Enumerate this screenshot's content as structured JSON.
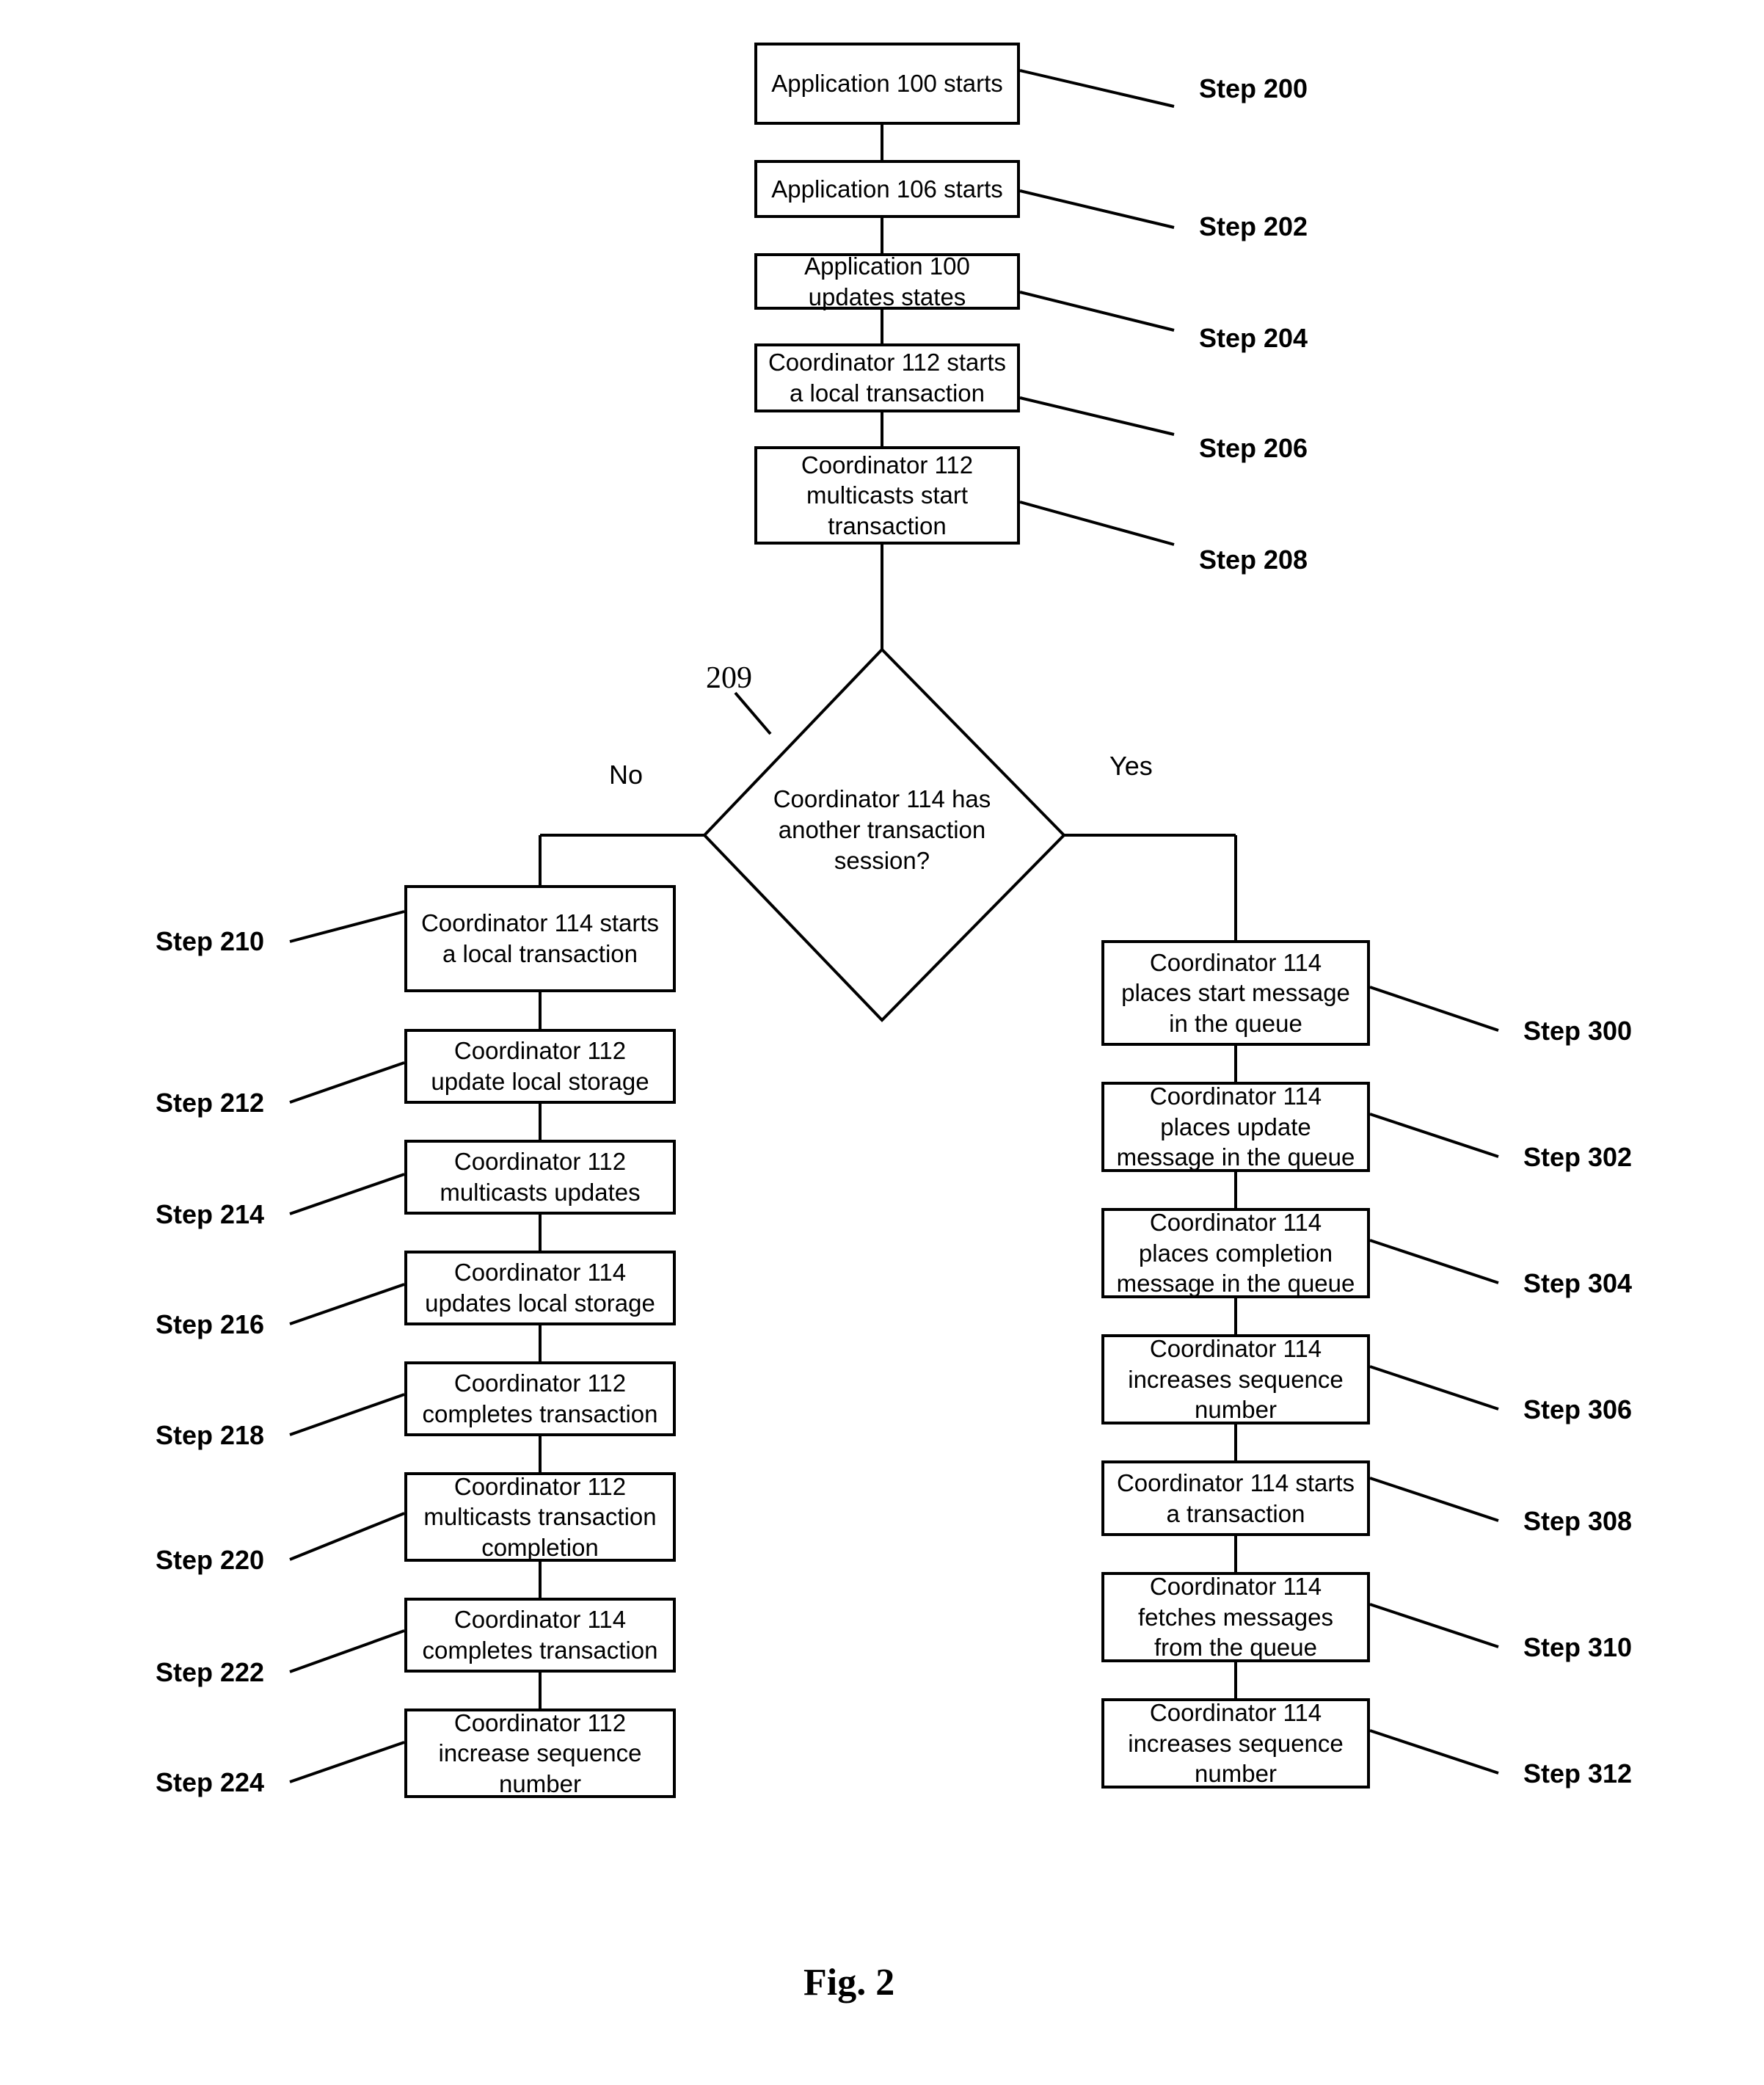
{
  "figure": {
    "caption": "Fig. 2",
    "reference_numeral": "209"
  },
  "branches": {
    "no_label": "No",
    "yes_label": "Yes"
  },
  "decision": {
    "text": "Coordinator 114 has\nanother transaction\nsession?",
    "step_ref": "209"
  },
  "main_column": {
    "nodes": [
      {
        "text": "Application 100 starts",
        "step": "Step 200"
      },
      {
        "text": "Application 106 starts",
        "step": "Step 202"
      },
      {
        "text": "Application 100\nupdates states",
        "step": "Step 204"
      },
      {
        "text": "Coordinator 112 starts\na local transaction",
        "step": "Step 206"
      },
      {
        "text": "Coordinator 112\nmulticasts start\ntransaction",
        "step": "Step 208"
      }
    ]
  },
  "no_column": {
    "nodes": [
      {
        "text": "Coordinator 114 starts\na local transaction",
        "step": "Step 210"
      },
      {
        "text": "Coordinator 112\nupdate local storage",
        "step": "Step 212"
      },
      {
        "text": "Coordinator 112\nmulticasts updates",
        "step": "Step 214"
      },
      {
        "text": "Coordinator 114\nupdates local storage",
        "step": "Step 216"
      },
      {
        "text": "Coordinator 112\ncompletes transaction",
        "step": "Step 218"
      },
      {
        "text": "Coordinator 112\nmulticasts transaction\ncompletion",
        "step": "Step 220"
      },
      {
        "text": "Coordinator 114\ncompletes transaction",
        "step": "Step 222"
      },
      {
        "text": "Coordinator 112\nincrease sequence\nnumber",
        "step": "Step 224"
      }
    ]
  },
  "yes_column": {
    "nodes": [
      {
        "text": "Coordinator 114\nplaces start message\nin the queue",
        "step": "Step 300"
      },
      {
        "text": "Coordinator 114\nplaces update\nmessage in the queue",
        "step": "Step 302"
      },
      {
        "text": "Coordinator 114\nplaces completion\nmessage in the queue",
        "step": "Step 304"
      },
      {
        "text": "Coordinator 114\nincreases sequence\nnumber",
        "step": "Step 306"
      },
      {
        "text": "Coordinator 114 starts\na transaction",
        "step": "Step 308"
      },
      {
        "text": "Coordinator 114\nfetches messages\nfrom the queue",
        "step": "Step 310"
      },
      {
        "text": "Coordinator 114\nincreases  sequence\nnumber",
        "step": "Step 312"
      }
    ]
  },
  "colors": {
    "stroke": "#000000",
    "fill": "#ffffff",
    "text": "#000000"
  }
}
